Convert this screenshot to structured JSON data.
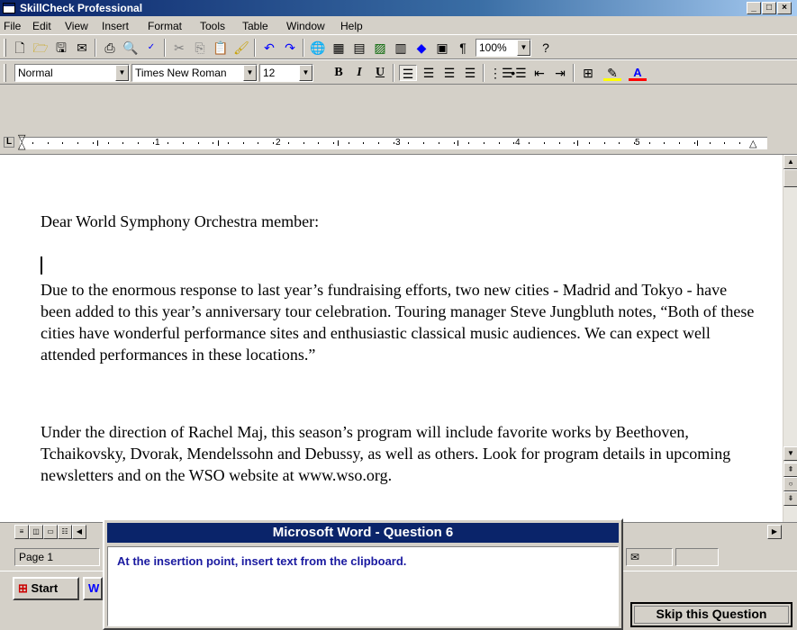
{
  "window": {
    "title": "SkillCheck Professional"
  },
  "menu": [
    "File",
    "Edit",
    "View",
    "Insert",
    "Format",
    "Tools",
    "Table",
    "Window",
    "Help"
  ],
  "toolbar": {
    "zoom": "100%"
  },
  "formatting": {
    "style": "Normal",
    "font": "Times New Roman",
    "size": "12",
    "bold": "B",
    "italic": "I",
    "underline": "U"
  },
  "ruler": {
    "numbers": [
      "1",
      "2",
      "3",
      "4",
      "5"
    ]
  },
  "document": {
    "paragraphs": [
      "Dear World Symphony Orchestra member:",
      "Due to the enormous response to last year’s fundraising efforts, two new cities - Madrid and Tokyo - have been added to this year’s anniversary tour celebration.  Touring manager Steve Jungbluth notes,  “Both of these cities have wonderful performance sites and enthusiastic classical music audiences.  We can expect well attended performances in these locations.”",
      "Under the direction of Rachel Maj, this season’s program will include favorite works by Beethoven, Tchaikovsky, Dvorak, Mendelssohn and Debussy, as well as others.  Look for program details in upcoming newsletters and on the WSO website at www.wso.org."
    ]
  },
  "status": {
    "page": "Page 1"
  },
  "taskbar": {
    "start": "Start"
  },
  "question": {
    "title": "Microsoft Word - Question 6",
    "instruction": "At the insertion point, insert text from the clipboard.",
    "skip_label": "Skip this Question"
  }
}
